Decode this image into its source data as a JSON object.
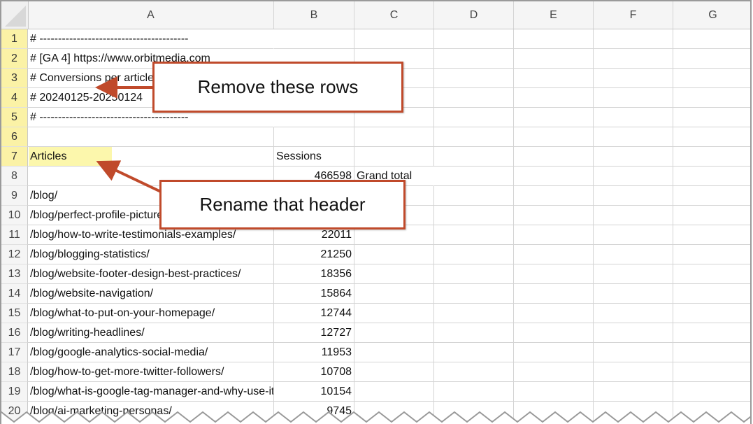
{
  "spreadsheet": {
    "columns": [
      "A",
      "B",
      "C",
      "D",
      "E",
      "F",
      "G"
    ],
    "rows": [
      {
        "num": "1",
        "a": "# ----------------------------------------",
        "b": "",
        "c": ""
      },
      {
        "num": "2",
        "a": "# [GA 4] https://www.orbitmedia.com",
        "b": "",
        "c": ""
      },
      {
        "num": "3",
        "a": "# Conversions per article",
        "b": "",
        "c": ""
      },
      {
        "num": "4",
        "a": "# 20240125-20250124",
        "b": "",
        "c": ""
      },
      {
        "num": "5",
        "a": "# ----------------------------------------",
        "b": "",
        "c": ""
      },
      {
        "num": "6",
        "a": "",
        "b": "",
        "c": ""
      },
      {
        "num": "7",
        "a": "Articles",
        "b": "Sessions",
        "c": ""
      },
      {
        "num": "8",
        "a": "",
        "b": "466598",
        "c": "Grand total"
      },
      {
        "num": "9",
        "a": "/blog/",
        "b": "",
        "c": ""
      },
      {
        "num": "10",
        "a": "/blog/perfect-profile-picture/",
        "b": "",
        "c": ""
      },
      {
        "num": "11",
        "a": "/blog/how-to-write-testimonials-examples/",
        "b": "22011",
        "c": ""
      },
      {
        "num": "12",
        "a": "/blog/blogging-statistics/",
        "b": "21250",
        "c": ""
      },
      {
        "num": "13",
        "a": "/blog/website-footer-design-best-practices/",
        "b": "18356",
        "c": ""
      },
      {
        "num": "14",
        "a": "/blog/website-navigation/",
        "b": "15864",
        "c": ""
      },
      {
        "num": "15",
        "a": "/blog/what-to-put-on-your-homepage/",
        "b": "12744",
        "c": ""
      },
      {
        "num": "16",
        "a": "/blog/writing-headlines/",
        "b": "12727",
        "c": ""
      },
      {
        "num": "17",
        "a": "/blog/google-analytics-social-media/",
        "b": "11953",
        "c": ""
      },
      {
        "num": "18",
        "a": "/blog/how-to-get-more-twitter-followers/",
        "b": "10708",
        "c": ""
      },
      {
        "num": "19",
        "a": "/blog/what-is-google-tag-manager-and-why-use-it/",
        "b": "10154",
        "c": ""
      },
      {
        "num": "20",
        "a": "/blog/ai-marketing-personas/",
        "b": "9745",
        "c": ""
      }
    ]
  },
  "annotations": {
    "remove_rows": "Remove these rows",
    "rename_header": "Rename that header"
  },
  "colors": {
    "callout_border": "#c04a2b",
    "highlight": "#fcf7ac",
    "selected_row_header": "#fbf2a6"
  }
}
